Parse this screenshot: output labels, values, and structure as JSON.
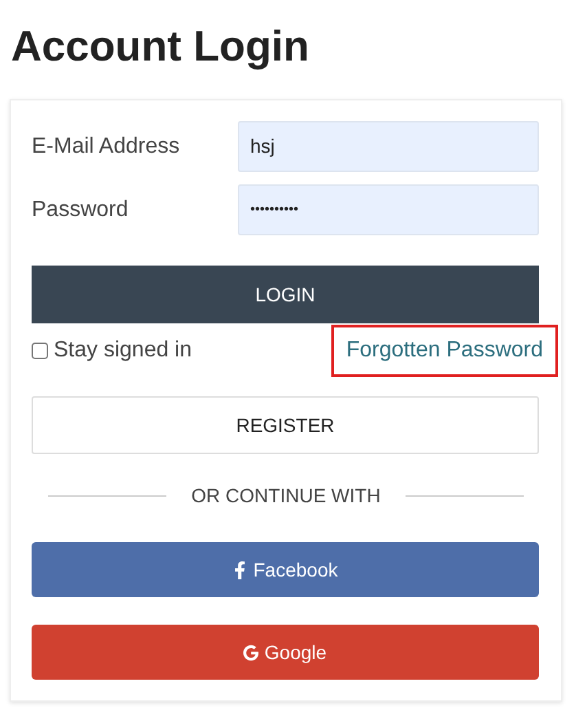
{
  "title": "Account Login",
  "fields": [
    {
      "label": "E-Mail Address",
      "value": "hsj",
      "kind": "email"
    },
    {
      "label": "Password",
      "value": "••••••••••",
      "kind": "password"
    }
  ],
  "login_button": "LOGIN",
  "stay_signed_in": {
    "label": "Stay signed in",
    "checked": false
  },
  "forgot_link": {
    "label": "Forgotten Password",
    "highlighted": true
  },
  "register_button": "REGISTER",
  "divider_text": "OR CONTINUE WITH",
  "social_buttons": [
    {
      "kind": "facebook",
      "label": "Facebook",
      "color": "#4e6ea9"
    },
    {
      "kind": "google",
      "label": "Google",
      "color": "#d04130"
    }
  ]
}
